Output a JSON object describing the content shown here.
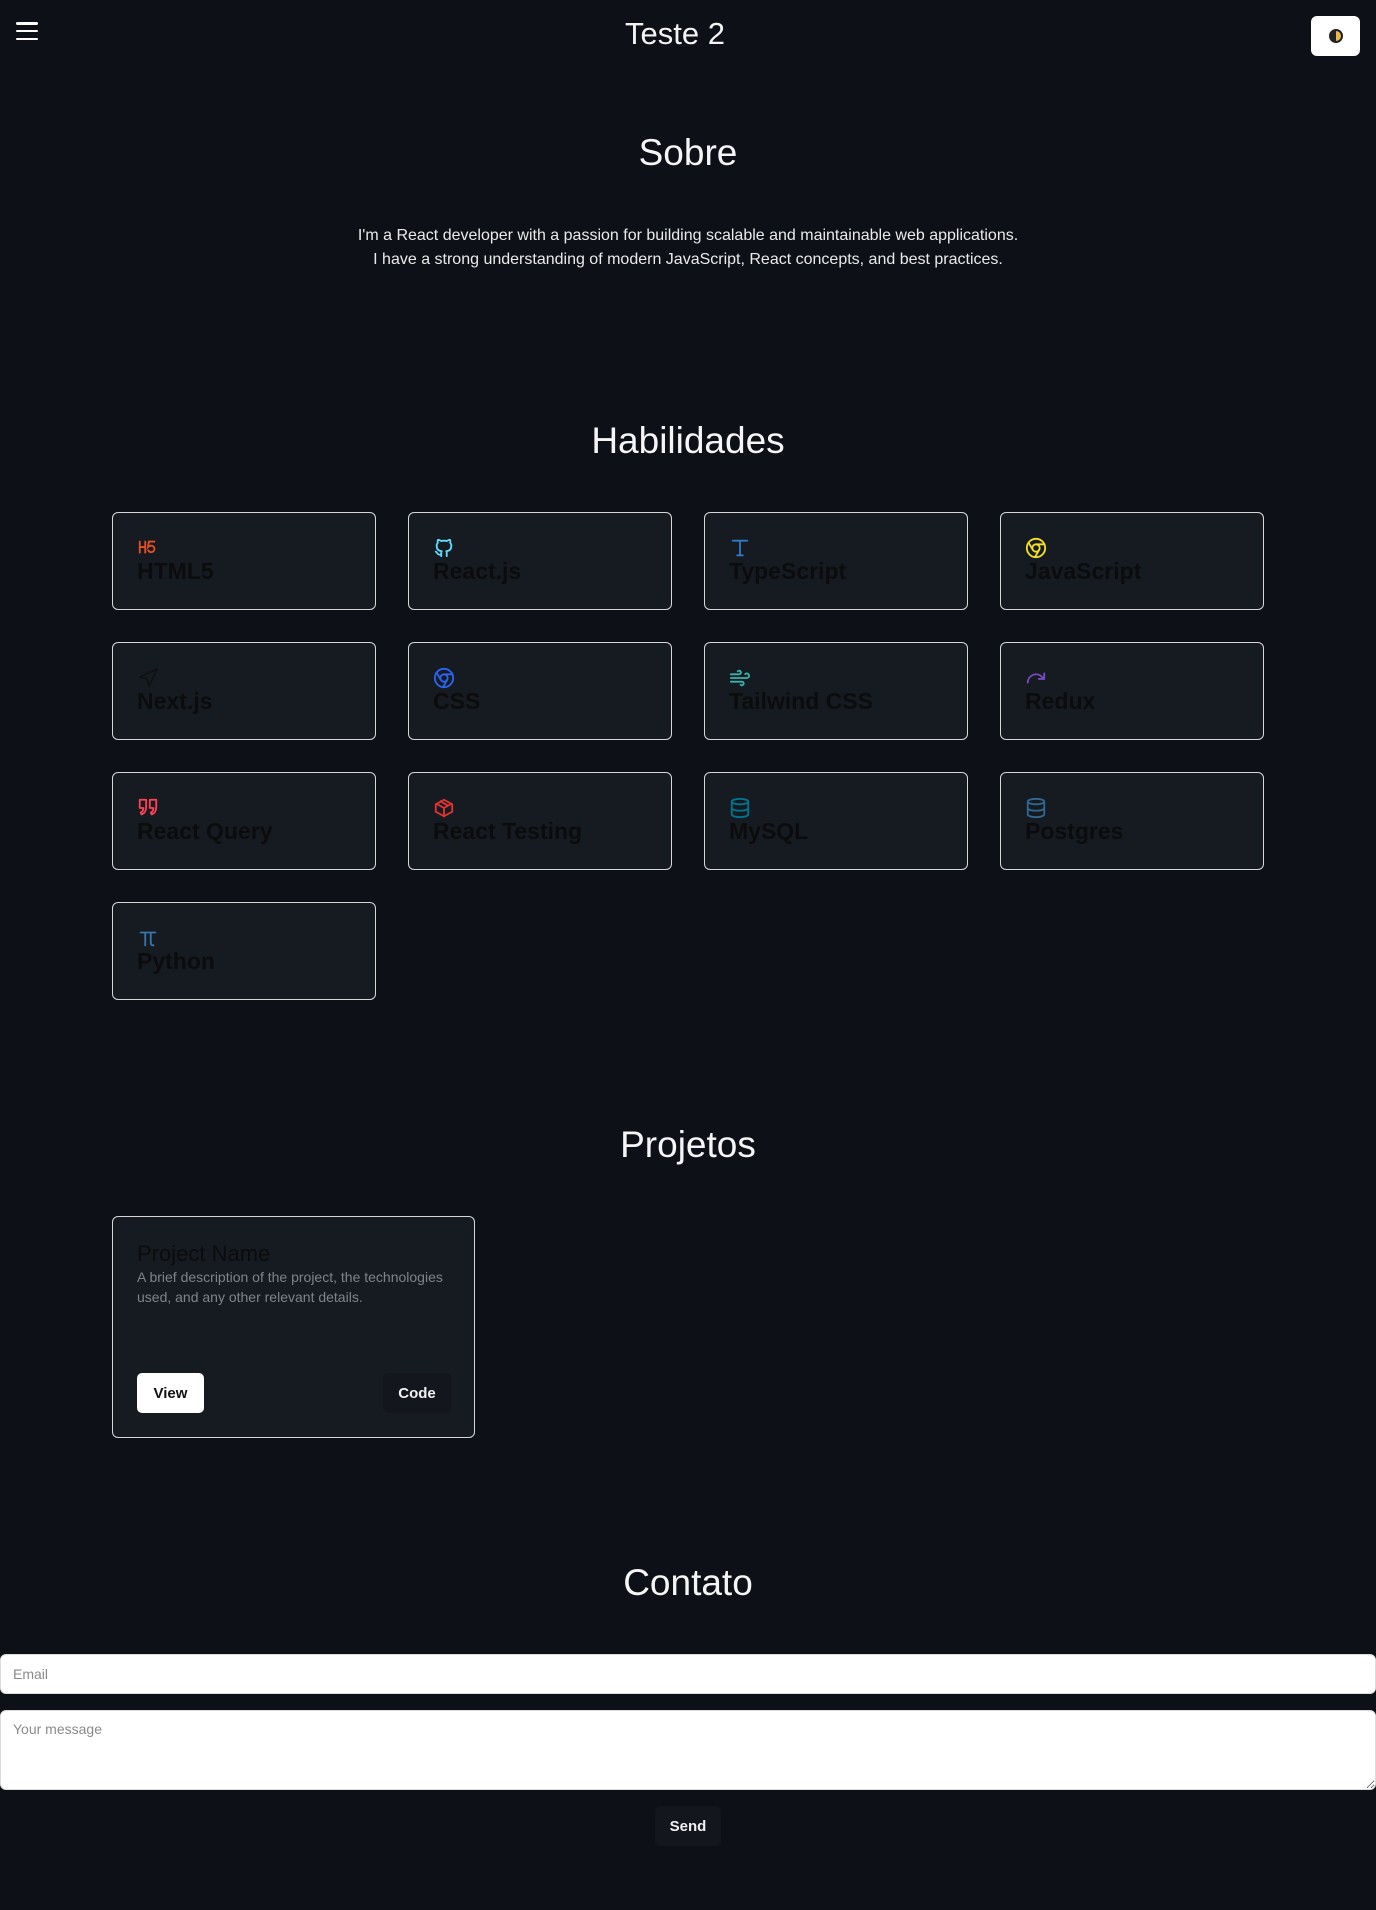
{
  "header": {
    "menu_icon": "hamburger-icon",
    "title": "Teste 2",
    "theme_icon": "contrast-icon"
  },
  "about": {
    "title": "Sobre",
    "text": "I'm a React developer with a passion for building scalable and maintainable web applications. I have a strong understanding of modern JavaScript, React concepts, and best practices."
  },
  "skills": {
    "title": "Habilidades",
    "items": [
      {
        "label": "HTML5",
        "icon": "html5-icon",
        "color": "#e34f26"
      },
      {
        "label": "React.js",
        "icon": "github-icon",
        "color": "#61dafb"
      },
      {
        "label": "TypeScript",
        "icon": "type-icon",
        "color": "#3178c6"
      },
      {
        "label": "JavaScript",
        "icon": "chrome-icon",
        "color": "#f7df1e"
      },
      {
        "label": "Next.js",
        "icon": "navigation-icon",
        "color": "#111111"
      },
      {
        "label": "CSS",
        "icon": "chrome-icon",
        "color": "#2965f1"
      },
      {
        "label": "Tailwind CSS",
        "icon": "wind-icon",
        "color": "#38b2ac"
      },
      {
        "label": "Redux",
        "icon": "redo-icon",
        "color": "#764abc"
      },
      {
        "label": "React Query",
        "icon": "quote-icon",
        "color": "#ff4154"
      },
      {
        "label": "React Testing",
        "icon": "package-icon",
        "color": "#e33332"
      },
      {
        "label": "MySQL",
        "icon": "database-icon",
        "color": "#00758f"
      },
      {
        "label": "Postgres",
        "icon": "database-icon",
        "color": "#336791"
      },
      {
        "label": "Python",
        "icon": "pi-icon",
        "color": "#3776ab"
      }
    ]
  },
  "projects": {
    "title": "Projetos",
    "items": [
      {
        "name": "Project Name",
        "description": "A brief description of the project, the technologies used, and any other relevant details.",
        "view_label": "View",
        "code_label": "Code"
      }
    ]
  },
  "contact": {
    "title": "Contato",
    "email_placeholder": "Email",
    "message_placeholder": "Your message",
    "send_label": "Send"
  },
  "colors": {
    "background": "#0d1117",
    "card_background": "#161b22",
    "card_border": "#d7d7d7"
  }
}
